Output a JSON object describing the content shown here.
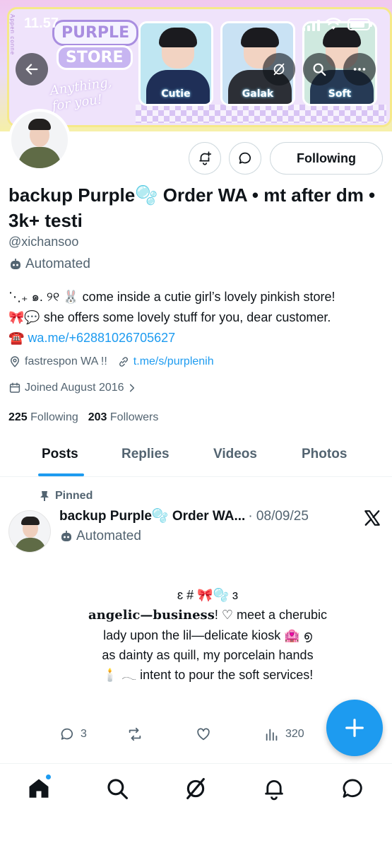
{
  "status_bar": {
    "time": "11.57"
  },
  "banner": {
    "side_text": "Appen conne",
    "logo_line1": "PURPLE",
    "logo_line2": "STORE",
    "tagline_line1": "Anything,",
    "tagline_line2": "for you!",
    "photo_labels": [
      "Cutie",
      "Galak",
      "Soft"
    ]
  },
  "profile": {
    "display_name": "backup Purple🫧 Order WA • mt after dm • 3k+ testi",
    "handle": "@xichansoo",
    "automated_label": "Automated",
    "following_button": "Following",
    "bio": {
      "line1": "⋱₊ ๑. ୨୧ 🐰 come inside a cutie girl’s lovely pinkish store!",
      "line2": "🎀💬 she offers some lovely stuff for you, dear customer.",
      "phone_emoji": "☎️",
      "link": "wa.me/+62881026705627"
    },
    "location": "fastrespon WA !!",
    "website": "t.me/s/purplenih",
    "joined": "Joined August 2016",
    "following_count": "225",
    "following_label": "Following",
    "followers_count": "203",
    "followers_label": "Followers"
  },
  "tabs": [
    {
      "label": "Posts",
      "active": true
    },
    {
      "label": "Replies",
      "active": false
    },
    {
      "label": "Videos",
      "active": false
    },
    {
      "label": "Photos",
      "active": false
    }
  ],
  "pinned_post": {
    "pinned_label": "Pinned",
    "author": "backup Purple🫧 Order WA...",
    "date": "· 08/09/25",
    "automated_label": "Automated",
    "body": {
      "line1": "ɛ # 🎀🫧 ɜ",
      "line2_bold": "angelic—business",
      "line2_rest": "! ♡ meet a cherubic",
      "line3": "lady upon the lil—delicate kiosk 🏩 ൭",
      "line4": "as dainty as quill,  my porcelain hands",
      "line5": "🕯️ 𓂃 intent to pour the soft services!"
    },
    "replies": "3",
    "reposts": "",
    "likes": "",
    "views": "320"
  },
  "colors": {
    "accent": "#1d9bf0",
    "text_primary": "#0f1419",
    "text_secondary": "#536471"
  }
}
